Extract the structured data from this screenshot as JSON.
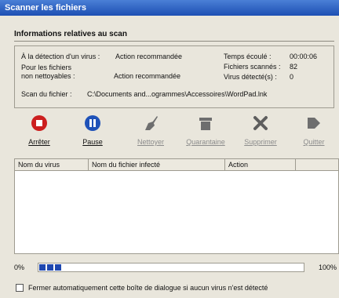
{
  "window": {
    "title": "Scanner les fichiers"
  },
  "section_title": "Informations relatives au scan",
  "info": {
    "on_virus_label": "À la détection d'un virus :",
    "on_virus_value": "Action recommandée",
    "uncleanable_label_1": "Pour les fichiers",
    "uncleanable_label_2": "non nettoyables :",
    "uncleanable_value": "Action recommandée",
    "elapsed_label": "Temps écoulé :",
    "elapsed_value": "00:00:06",
    "scanned_label": "Fichiers scannés :",
    "scanned_value": "82",
    "detected_label": "Virus détecté(s) :",
    "detected_value": "0",
    "file_label": "Scan du fichier :",
    "file_value": "C:\\Documents and...ogrammes\\Accessoires\\WordPad.lnk"
  },
  "toolbar": {
    "stop": "Arrêter",
    "pause": "Pause",
    "clean": "Nettoyer",
    "quarantine": "Quarantaine",
    "delete": "Supprimer",
    "quit": "Quitter"
  },
  "table": {
    "columns": [
      "Nom du virus",
      "Nom du fichier infecté",
      "Action"
    ]
  },
  "progress": {
    "start_label": "0%",
    "end_label": "100%",
    "value": 0.1
  },
  "auto_close_label": "Fermer automatiquement cette boîte de dialogue si aucun virus n'est détecté",
  "colors": {
    "title_bar": "#1d4fb3",
    "stop_icon": "#cc1f1f",
    "pause_icon": "#1f52b8",
    "disabled_icon": "#6e6e6e",
    "progress_fill": "#1f48b0"
  },
  "icons": {
    "stop": "stop-icon",
    "pause": "pause-icon",
    "clean": "broom-icon",
    "quarantine": "quarantine-icon",
    "delete": "delete-x-icon",
    "quit": "exit-arrow-icon"
  }
}
